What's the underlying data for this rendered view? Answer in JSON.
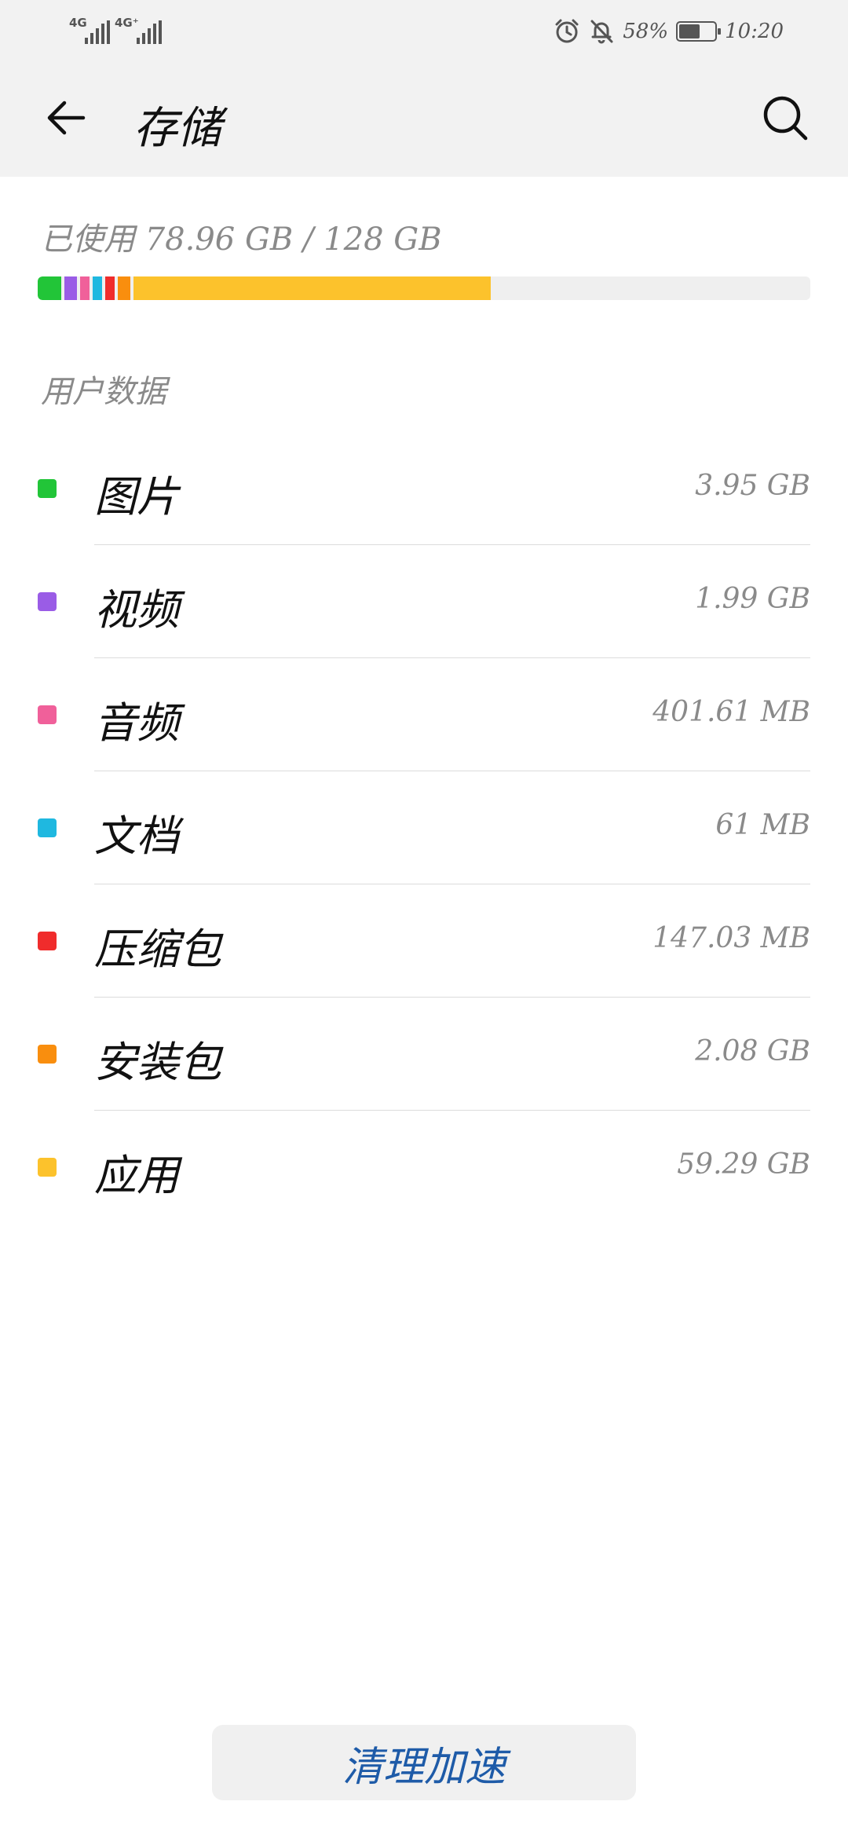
{
  "status_bar": {
    "sim1_label": "4G",
    "sim2_label": "4G⁺",
    "alarm_icon": "alarm-clock-icon",
    "mute_icon": "bell-off-icon",
    "battery_percent": "58%",
    "battery_level": 0.58,
    "time": "10:20"
  },
  "header": {
    "back_icon": "arrow-left-icon",
    "title": "存储",
    "search_icon": "search-icon"
  },
  "usage": {
    "text": "已使用 78.96 GB / 128 GB",
    "used_gb": 78.96,
    "total_gb": 128,
    "track_color": "#efefef"
  },
  "section": {
    "title": "用户数据"
  },
  "categories": [
    {
      "label": "图片",
      "value": "3.95 GB",
      "color": "#22c538"
    },
    {
      "label": "视频",
      "value": "1.99 GB",
      "color": "#9a5ce6"
    },
    {
      "label": "音频",
      "value": "401.61 MB",
      "color": "#f0609a"
    },
    {
      "label": "文档",
      "value": "61 MB",
      "color": "#1fb8e0"
    },
    {
      "label": "压缩包",
      "value": "147.03 MB",
      "color": "#f02c2c"
    },
    {
      "label": "安装包",
      "value": "2.08 GB",
      "color": "#f98e0e"
    },
    {
      "label": "应用",
      "value": "59.29 GB",
      "color": "#fcc22c"
    }
  ],
  "footer": {
    "clean_button_label": "清理加速",
    "accent_color": "#1e5ba8"
  }
}
